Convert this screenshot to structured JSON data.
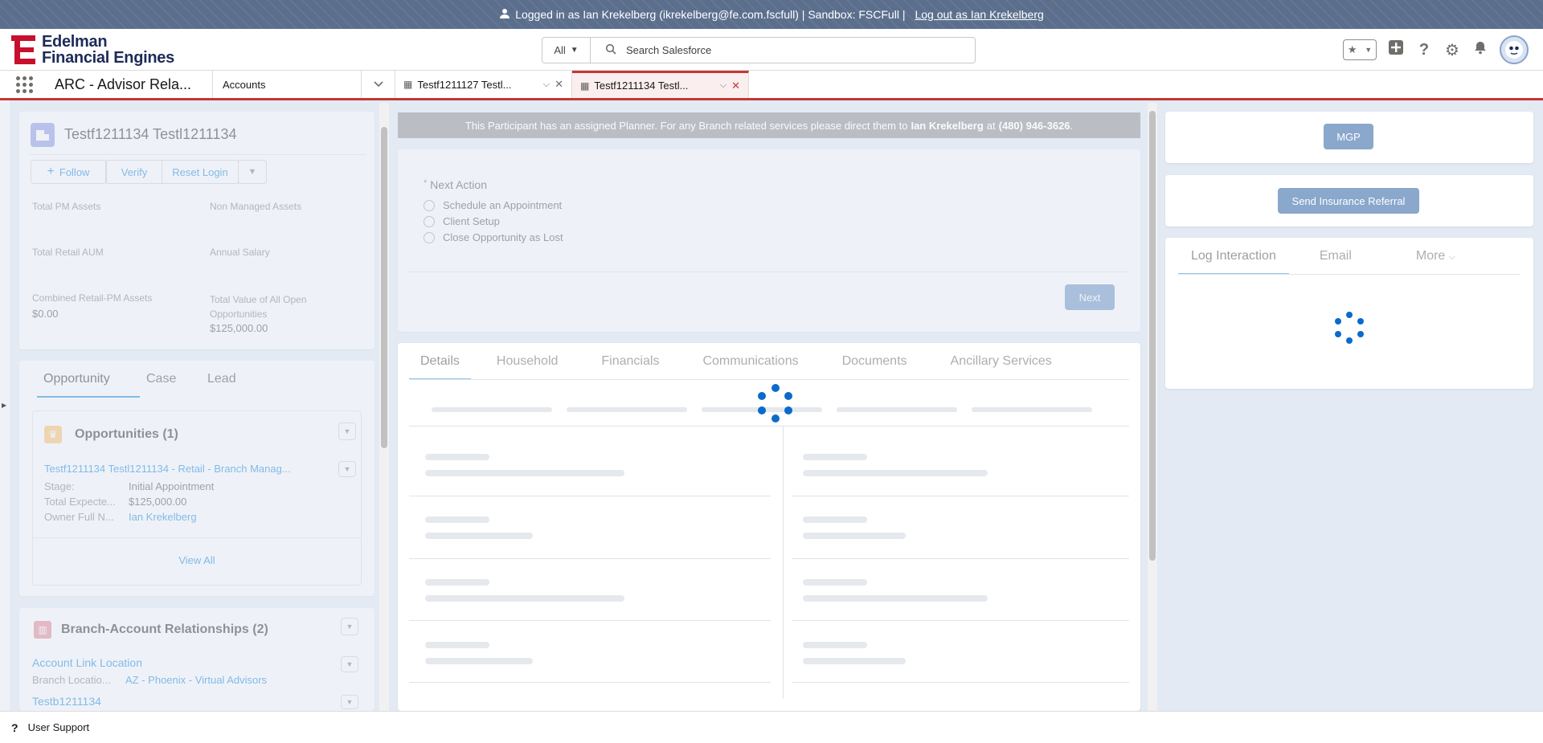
{
  "banner": {
    "text": "Logged in as Ian Krekelberg (ikrekelberg@fe.com.fscfull) | Sandbox: FSCFull |",
    "logout_link": "Log out as Ian Krekelberg"
  },
  "header": {
    "logo_line1": "Edelman",
    "logo_line2": "Financial Engines",
    "search_scope": "All",
    "search_placeholder": "Search Salesforce"
  },
  "nav": {
    "app_name": "ARC - Advisor Rela...",
    "object": "Accounts",
    "tabs": [
      {
        "label": "Testf1211127 Testl..."
      },
      {
        "label": "Testf1211134 Testl..."
      }
    ]
  },
  "record": {
    "title": "Testf1211134 Testl1211134",
    "buttons": {
      "follow": "Follow",
      "verify": "Verify",
      "reset_login": "Reset Login"
    },
    "fields": {
      "total_pm_assets_label": "Total PM Assets",
      "non_managed_label": "Non Managed Assets",
      "total_retail_aum_label": "Total Retail AUM",
      "annual_salary_label": "Annual Salary",
      "combined_label": "Combined Retail-PM Assets",
      "combined_value": "$0.00",
      "total_value_label_1": "Total Value of All Open",
      "total_value_label_2": "Opportunities",
      "total_value_value": "$125,000.00"
    }
  },
  "related": {
    "tabs": [
      "Opportunity",
      "Case",
      "Lead"
    ],
    "opportunities_title": "Opportunities (1)",
    "opp_name": "Testf1211134 Testl1211134 - Retail - Branch Manag...",
    "opp_fields": [
      {
        "label": "Stage:",
        "value": "Initial Appointment"
      },
      {
        "label": "Total Expecte...",
        "value": "$125,000.00"
      },
      {
        "label": "Owner Full N...",
        "value": "Ian Krekelberg"
      }
    ],
    "view_all": "View All",
    "branch_title": "Branch-Account Relationships (2)",
    "branch_item1": "Account Link Location",
    "branch_item1_label": "Branch Locatio...",
    "branch_item1_value": "AZ - Phoenix - Virtual Advisors",
    "branch_item2": "Testb1211134"
  },
  "center": {
    "notice_pre": "This Participant has an assigned Planner. For any Branch related services please direct them to",
    "notice_name": "Ian Krekelberg",
    "notice_mid": "at",
    "notice_phone": "(480) 946-3626",
    "notice_end": ".",
    "next_action_label": "Next Action",
    "options": [
      "Schedule an Appointment",
      "Client Setup",
      "Close Opportunity as Lost"
    ],
    "next_button": "Next",
    "detail_tabs": [
      "Details",
      "Household",
      "Financials",
      "Communications",
      "Documents",
      "Ancillary Services"
    ]
  },
  "right": {
    "mgp": "MGP",
    "send_referral": "Send Insurance Referral",
    "activity_tabs": [
      "Log Interaction",
      "Email",
      "More"
    ]
  },
  "footer": {
    "user_support": "User Support"
  }
}
